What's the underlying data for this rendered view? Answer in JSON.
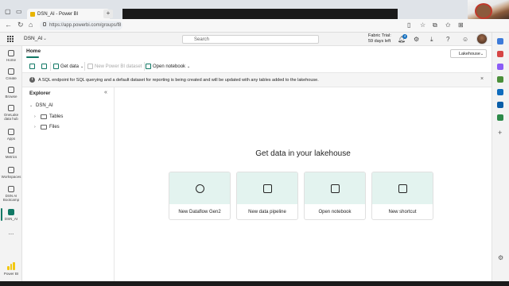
{
  "browser": {
    "tab_title": "DSN_AI - Power BI",
    "url": "https://app.powerbi.com/groups/f8"
  },
  "header": {
    "workspace": "DSN_AI",
    "search_placeholder": "Search",
    "trial_line1": "Fabric Trial:",
    "trial_line2": "59 days left",
    "notification_count": "4"
  },
  "leftnav": {
    "items": [
      {
        "label": "Home"
      },
      {
        "label": "Create"
      },
      {
        "label": "Browse"
      },
      {
        "label": "OneLake data hub"
      },
      {
        "label": "Apps"
      },
      {
        "label": "Metrics"
      },
      {
        "label": "Workspaces"
      },
      {
        "label": "DSN AI Bootcamp"
      },
      {
        "label": "DSN_AI"
      },
      {
        "label": "..."
      }
    ],
    "footer": "Power BI"
  },
  "ribbon": {
    "tab": "Home",
    "view_select": "Lakehouse",
    "get_data": "Get data",
    "new_dataset": "New Power BI dataset",
    "open_notebook": "Open notebook"
  },
  "info": {
    "icon": "i",
    "text": "A SQL endpoint for SQL querying and a default dataset for reporting is being created and will be updated with any tables added to the lakehouse."
  },
  "explorer": {
    "title": "Explorer",
    "root": "DSN_AI",
    "children": [
      "Tables",
      "Files"
    ]
  },
  "main": {
    "title": "Get data in your lakehouse",
    "cards": [
      {
        "label": "New Dataflow Gen2"
      },
      {
        "label": "New data pipeline"
      },
      {
        "label": "Open notebook"
      },
      {
        "label": "New shortcut"
      }
    ]
  },
  "colors": {
    "accent": "#117865",
    "card_bg": "#e3f3ef"
  }
}
